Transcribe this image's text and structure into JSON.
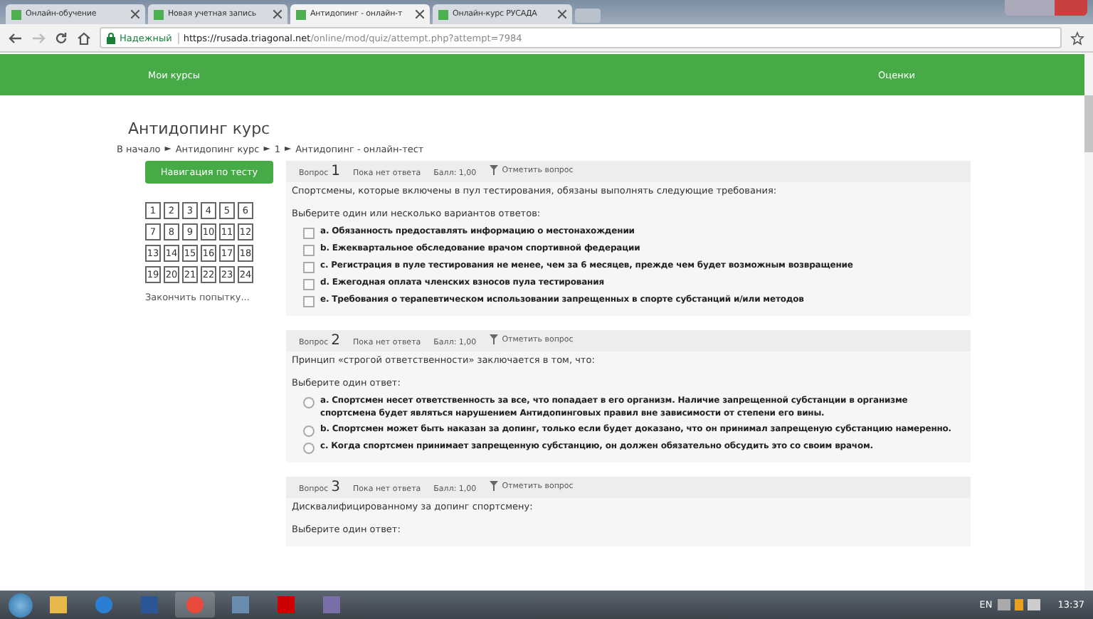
{
  "browser": {
    "tabs": [
      {
        "title": "Онлайн-обучение",
        "selected": false
      },
      {
        "title": "Новая учетная запись",
        "selected": false
      },
      {
        "title": "Антидопинг - онлайн-т",
        "selected": true
      },
      {
        "title": "Онлайн-курс РУСАДА",
        "selected": false
      }
    ],
    "secure_label": "Надежный",
    "url_host": "https://rusada.triagonal.net",
    "url_path": "/online/mod/quiz/attempt.php?attempt=7984"
  },
  "navbar": {
    "left": "Мои курсы",
    "right": "Оценки"
  },
  "page_title": "Антидопинг курс",
  "breadcrumb": [
    "В начало",
    "Антидопинг курс",
    "1",
    "Антидопинг - онлайн-тест"
  ],
  "breadcrumb_separator": "►",
  "quiz_nav": {
    "title": "Навигация по тесту",
    "buttons": [
      "1",
      "2",
      "3",
      "4",
      "5",
      "6",
      "7",
      "8",
      "9",
      "10",
      "11",
      "12",
      "13",
      "14",
      "15",
      "16",
      "17",
      "18",
      "19",
      "20",
      "21",
      "22",
      "23",
      "24"
    ],
    "finish": "Закончить попытку..."
  },
  "questions": [
    {
      "label": "Вопрос",
      "number": "1",
      "status": "Пока нет ответа",
      "score": "Балл: 1,00",
      "flag": "Отметить вопрос",
      "text": "Спортсмены, которые включены в пул тестирования, обязаны выполнять следующие требования:",
      "prompt": "Выберите один или несколько вариантов ответов:",
      "kind": "checkbox",
      "options": [
        {
          "text": "a. Обязанность предоставлять информацию о местонахождении",
          "selected": false
        },
        {
          "text": "b. Ежеквартальное обследование врачом спортивной федерации",
          "selected": false
        },
        {
          "text": "c. Регистрация в пуле тестирования не менее, чем за 6 месяцев, прежде чем будет возможным возвращение",
          "selected": false
        },
        {
          "text": "d. Ежегодная оплата членских взносов пула тестирования",
          "selected": false
        },
        {
          "text": "e. Требования о терапевтическом использовании запрещенных в спорте субстанций и/или методов",
          "selected": false
        }
      ]
    },
    {
      "label": "Вопрос",
      "number": "2",
      "status": "Пока нет ответа",
      "score": "Балл: 1,00",
      "flag": "Отметить вопрос",
      "text": "Принцип «строгой ответственности» заключается в том, что:",
      "prompt": "Выберите один ответ:",
      "kind": "radio",
      "options": [
        {
          "text": "a. Спортсмен несет ответственность за все, что попадает в его организм. Наличие запрещенной субстанции в организме спортсмена будет являться нарушением Антидопинговых правил вне зависимости от степени его вины.",
          "selected": false
        },
        {
          "text": "b. Спортсмен может быть наказан за допинг, только если будет доказано, что он принимал запрещеную субстанцию намеренно.",
          "selected": false
        },
        {
          "text": "c. Когда спортсмен принимает запрещенную субстанцию, он должен обязательно обсудить это со своим врачом.",
          "selected": false
        }
      ]
    },
    {
      "label": "Вопрос",
      "number": "3",
      "status": "Пока нет ответа",
      "score": "Балл: 1,00",
      "flag": "Отметить вопрос",
      "text": "Дисквалифицированному за допинг спортсмену:",
      "prompt": "Выберите один ответ:"
    }
  ],
  "taskbar": {
    "language": "EN",
    "time": "13:37"
  }
}
